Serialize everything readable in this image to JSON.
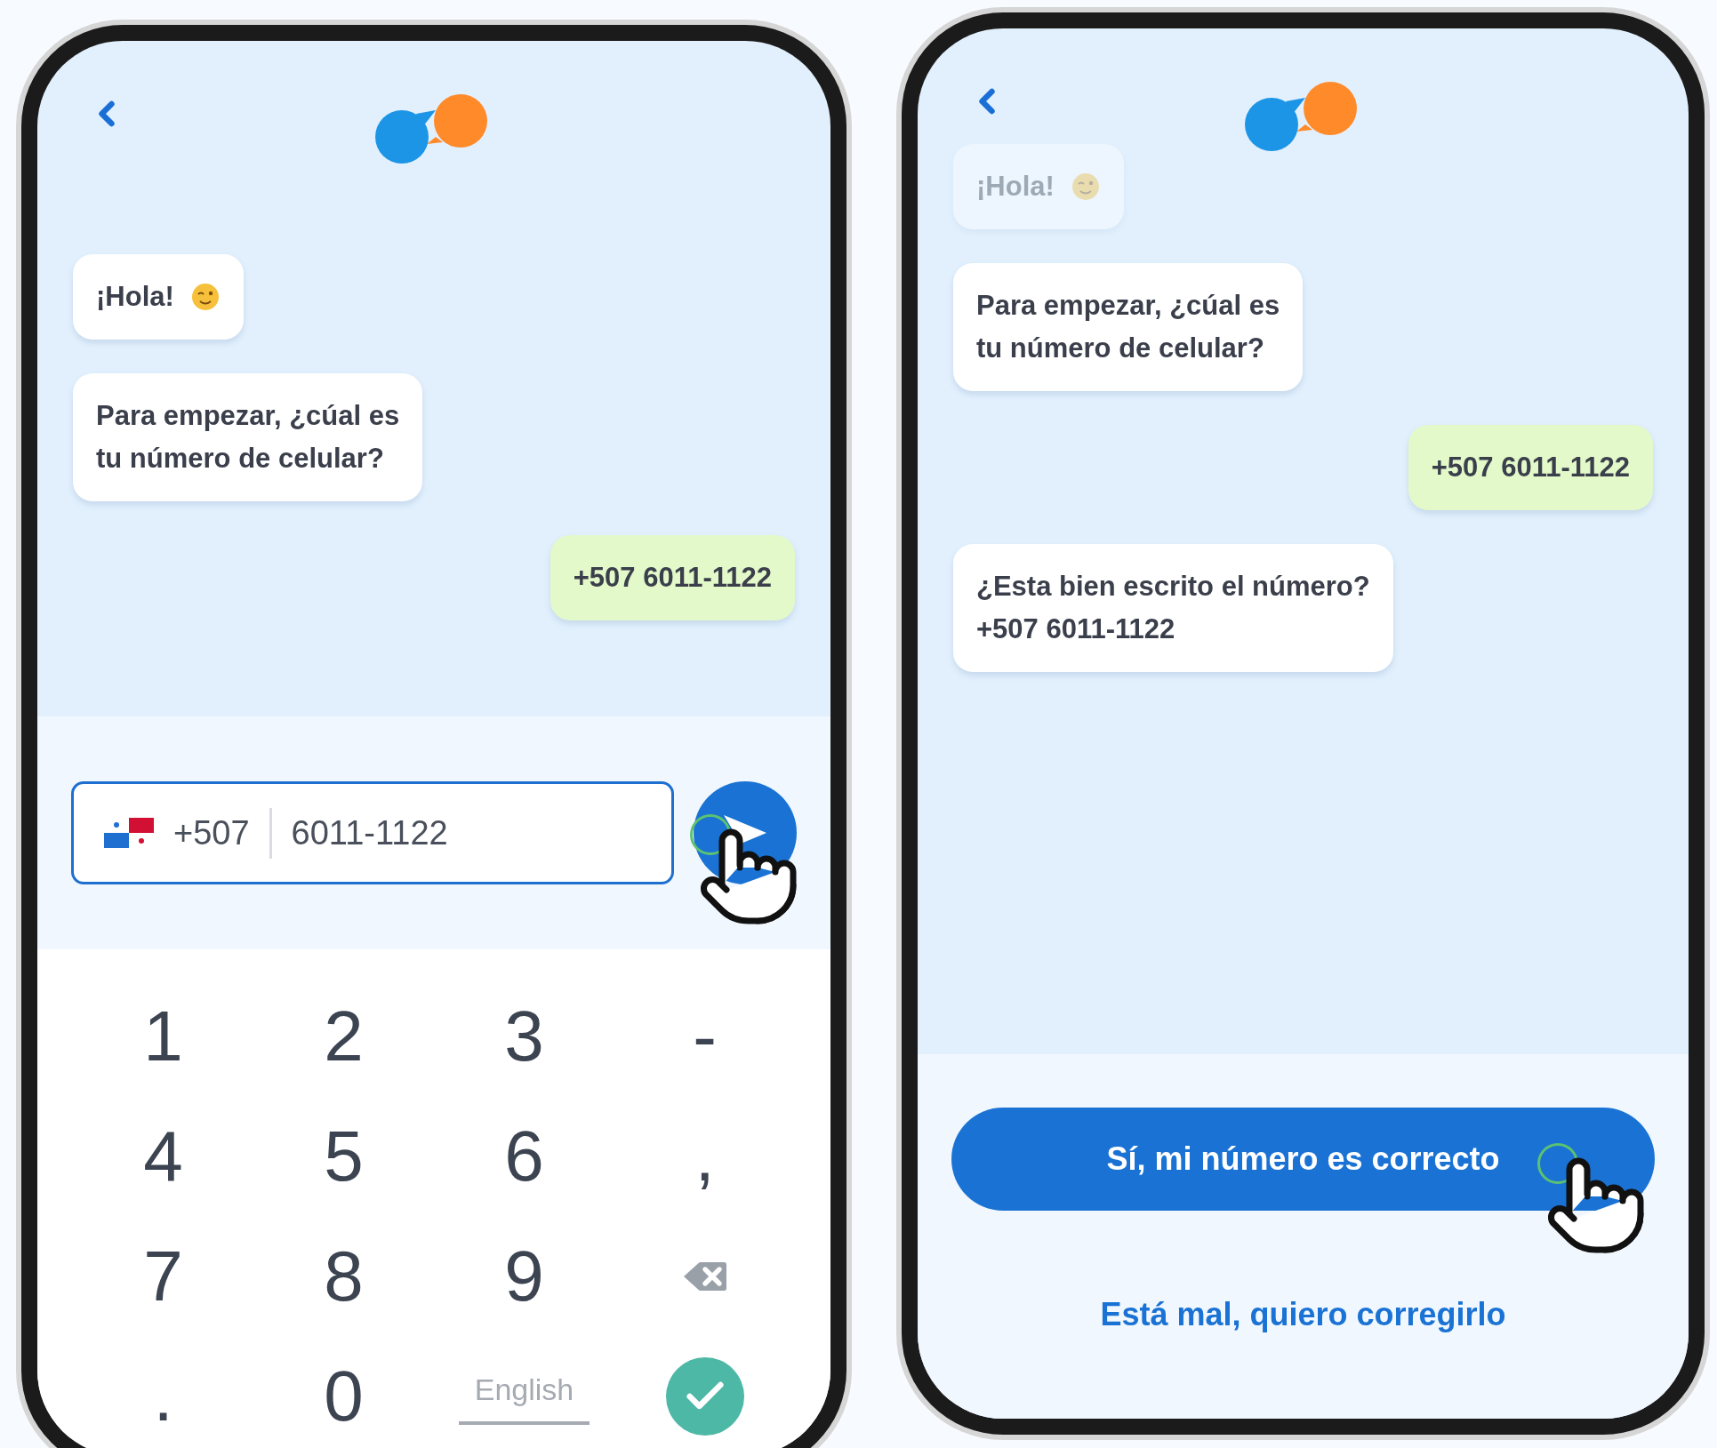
{
  "phones": [
    {
      "kind": "keypad",
      "messages": [
        {
          "kind": "bot",
          "text": "¡Hola!",
          "wink": true,
          "faded": false
        },
        {
          "kind": "bot",
          "text": "Para empezar, ¿cúal es\ntu número de celular?",
          "wink": false,
          "faded": false
        },
        {
          "kind": "user",
          "text": "+507 6011-1122",
          "wink": false,
          "faded": false
        }
      ],
      "input": {
        "country_code": "+507",
        "value": "6011-1122"
      },
      "keys": [
        {
          "kind": "char",
          "label": "1"
        },
        {
          "kind": "char",
          "label": "2"
        },
        {
          "kind": "char",
          "label": "3"
        },
        {
          "kind": "char",
          "label": "-"
        },
        {
          "kind": "char",
          "label": "4"
        },
        {
          "kind": "char",
          "label": "5"
        },
        {
          "kind": "char",
          "label": "6"
        },
        {
          "kind": "char",
          "label": ","
        },
        {
          "kind": "char",
          "label": "7"
        },
        {
          "kind": "char",
          "label": "8"
        },
        {
          "kind": "char",
          "label": "9"
        },
        {
          "kind": "backspace"
        },
        {
          "kind": "char",
          "label": "."
        },
        {
          "kind": "char",
          "label": "0"
        },
        {
          "kind": "lang",
          "label": "English"
        },
        {
          "kind": "done"
        }
      ]
    },
    {
      "kind": "confirm",
      "messages": [
        {
          "kind": "bot",
          "text": "¡Hola!",
          "wink": true,
          "faded": true
        },
        {
          "kind": "bot",
          "text": "Para empezar, ¿cúal es\ntu número de celular?",
          "wink": false,
          "faded": false
        },
        {
          "kind": "user",
          "text": "+507 6011-1122",
          "wink": false,
          "faded": false
        },
        {
          "kind": "bot",
          "text": "¿Esta bien escrito el número?\n+507 6011-1122",
          "wink": false,
          "faded": false
        }
      ],
      "confirm_button": "Sí, mi número es correcto",
      "fix_link": "Está mal, quiero corregirlo"
    }
  ]
}
